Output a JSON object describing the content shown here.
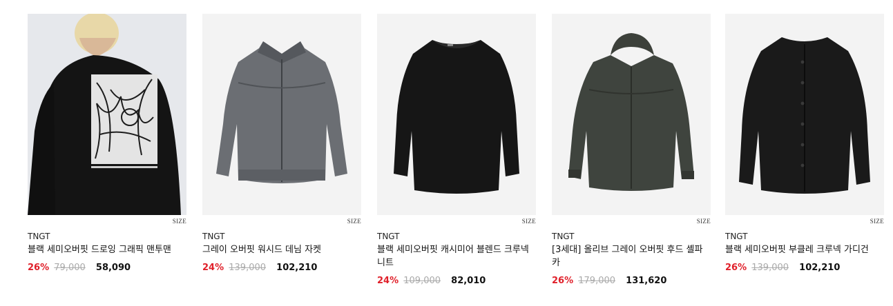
{
  "size_label": "SIZE",
  "products": [
    {
      "brand": "TNGT",
      "name": "블랙 세미오버핏 드로잉 그래픽 맨투맨",
      "discount": "26%",
      "original_price": "79,000",
      "sale_price": "58,090",
      "image": "black-graphic-sweatshirt-photo"
    },
    {
      "brand": "TNGT",
      "name": "그레이 오버핏 워시드 데님 자켓",
      "discount": "24%",
      "original_price": "139,000",
      "sale_price": "102,210",
      "image": "gray-washed-denim-jacket-photo"
    },
    {
      "brand": "TNGT",
      "name": "블랙 세미오버핏 캐시미어 블렌드 크루넥 니트",
      "discount": "24%",
      "original_price": "109,000",
      "sale_price": "82,010",
      "image": "black-cashmere-knit-photo"
    },
    {
      "brand": "TNGT",
      "name": "[3세대] 올리브 그레이 오버핏 후드 셸파카",
      "discount": "26%",
      "original_price": "179,000",
      "sale_price": "131,620",
      "image": "olive-hooded-parka-photo"
    },
    {
      "brand": "TNGT",
      "name": "블랙 세미오버핏 부클레 크루넥 가디건",
      "discount": "26%",
      "original_price": "139,000",
      "sale_price": "102,210",
      "image": "black-boucle-cardigan-photo"
    }
  ]
}
